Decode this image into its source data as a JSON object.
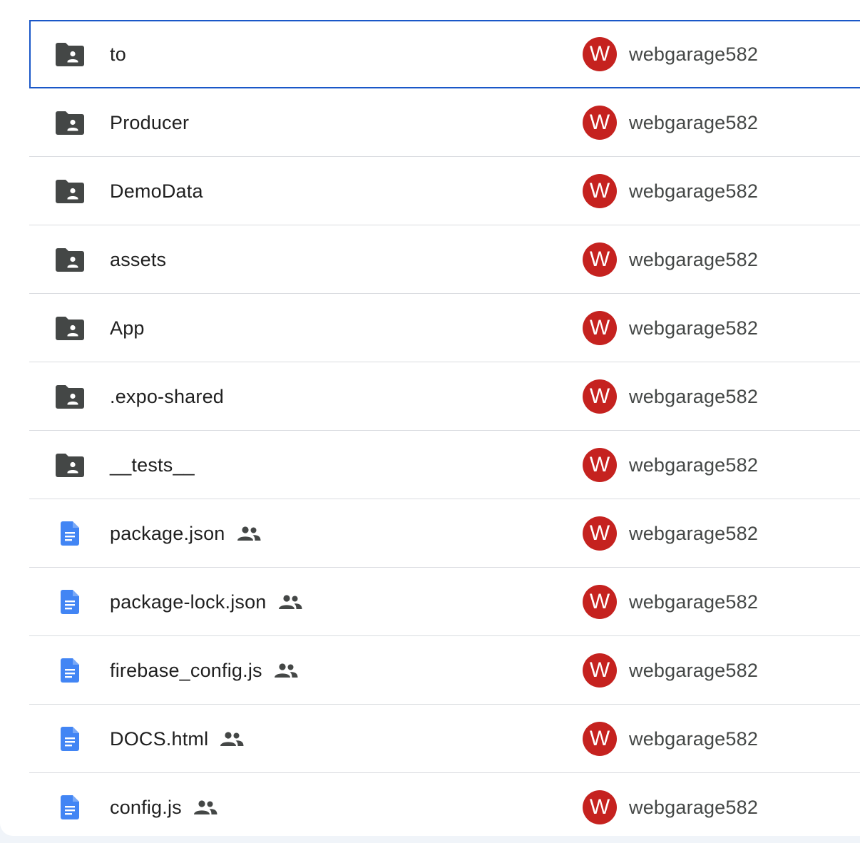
{
  "colors": {
    "selection_border": "#1a57c8",
    "folder_icon": "#444746",
    "doc_icon": "#4285f4",
    "avatar_bg": "#c5221f",
    "divider": "#dadce0"
  },
  "files": [
    {
      "name": "to",
      "type": "shared-folder",
      "icon": "shared-folder-icon",
      "shared": false,
      "selected": true,
      "owner_initial": "W",
      "owner": "webgarage582"
    },
    {
      "name": "Producer",
      "type": "shared-folder",
      "icon": "shared-folder-icon",
      "shared": false,
      "selected": false,
      "owner_initial": "W",
      "owner": "webgarage582"
    },
    {
      "name": "DemoData",
      "type": "shared-folder",
      "icon": "shared-folder-icon",
      "shared": false,
      "selected": false,
      "owner_initial": "W",
      "owner": "webgarage582"
    },
    {
      "name": "assets",
      "type": "shared-folder",
      "icon": "shared-folder-icon",
      "shared": false,
      "selected": false,
      "owner_initial": "W",
      "owner": "webgarage582"
    },
    {
      "name": "App",
      "type": "shared-folder",
      "icon": "shared-folder-icon",
      "shared": false,
      "selected": false,
      "owner_initial": "W",
      "owner": "webgarage582"
    },
    {
      "name": ".expo-shared",
      "type": "shared-folder",
      "icon": "shared-folder-icon",
      "shared": false,
      "selected": false,
      "owner_initial": "W",
      "owner": "webgarage582"
    },
    {
      "name": "__tests__",
      "type": "shared-folder",
      "icon": "shared-folder-icon",
      "shared": false,
      "selected": false,
      "owner_initial": "W",
      "owner": "webgarage582"
    },
    {
      "name": "package.json",
      "type": "document",
      "icon": "document-icon",
      "shared": true,
      "selected": false,
      "owner_initial": "W",
      "owner": "webgarage582"
    },
    {
      "name": "package-lock.json",
      "type": "document",
      "icon": "document-icon",
      "shared": true,
      "selected": false,
      "owner_initial": "W",
      "owner": "webgarage582"
    },
    {
      "name": "firebase_config.js",
      "type": "document",
      "icon": "document-icon",
      "shared": true,
      "selected": false,
      "owner_initial": "W",
      "owner": "webgarage582"
    },
    {
      "name": "DOCS.html",
      "type": "document",
      "icon": "document-icon",
      "shared": true,
      "selected": false,
      "owner_initial": "W",
      "owner": "webgarage582"
    },
    {
      "name": "config.js",
      "type": "document",
      "icon": "document-icon",
      "shared": true,
      "selected": false,
      "owner_initial": "W",
      "owner": "webgarage582"
    }
  ]
}
